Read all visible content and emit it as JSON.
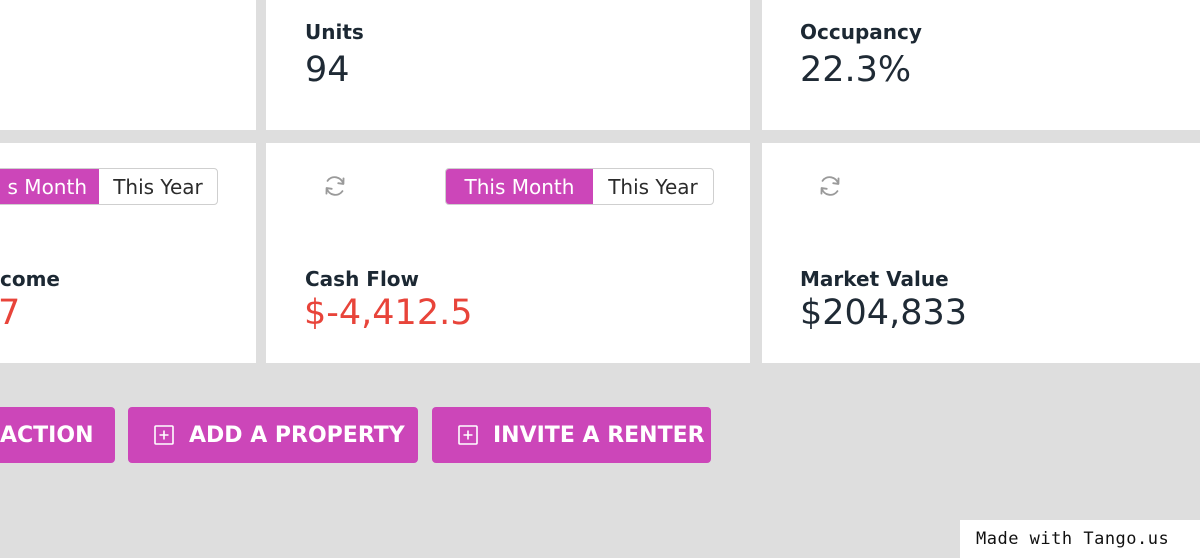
{
  "stats_row": {
    "units": {
      "label": "Units",
      "value": "94"
    },
    "occupancy": {
      "label": "Occupancy",
      "value": "22.3%"
    }
  },
  "finance_row": {
    "income": {
      "label_partial": "come",
      "value_partial": "7",
      "toggle": {
        "active": "s Month",
        "inactive": "This Year"
      }
    },
    "cash_flow": {
      "label": "Cash Flow",
      "value": "$-4,412.5",
      "toggle": {
        "active": "This Month",
        "inactive": "This Year"
      }
    },
    "market_value": {
      "label": "Market Value",
      "value": "$204,833"
    }
  },
  "actions": {
    "transaction_partial": "ACTION",
    "add_property": "ADD A PROPERTY",
    "invite_renter": "INVITE A RENTER"
  },
  "watermark": "Made with Tango.us",
  "colors": {
    "accent": "#cc46b9",
    "negative": "#e8443a",
    "background": "#dedede",
    "text": "#1f2a35"
  },
  "icons": {
    "refresh": "refresh-icon",
    "plus": "plus-square-icon"
  }
}
